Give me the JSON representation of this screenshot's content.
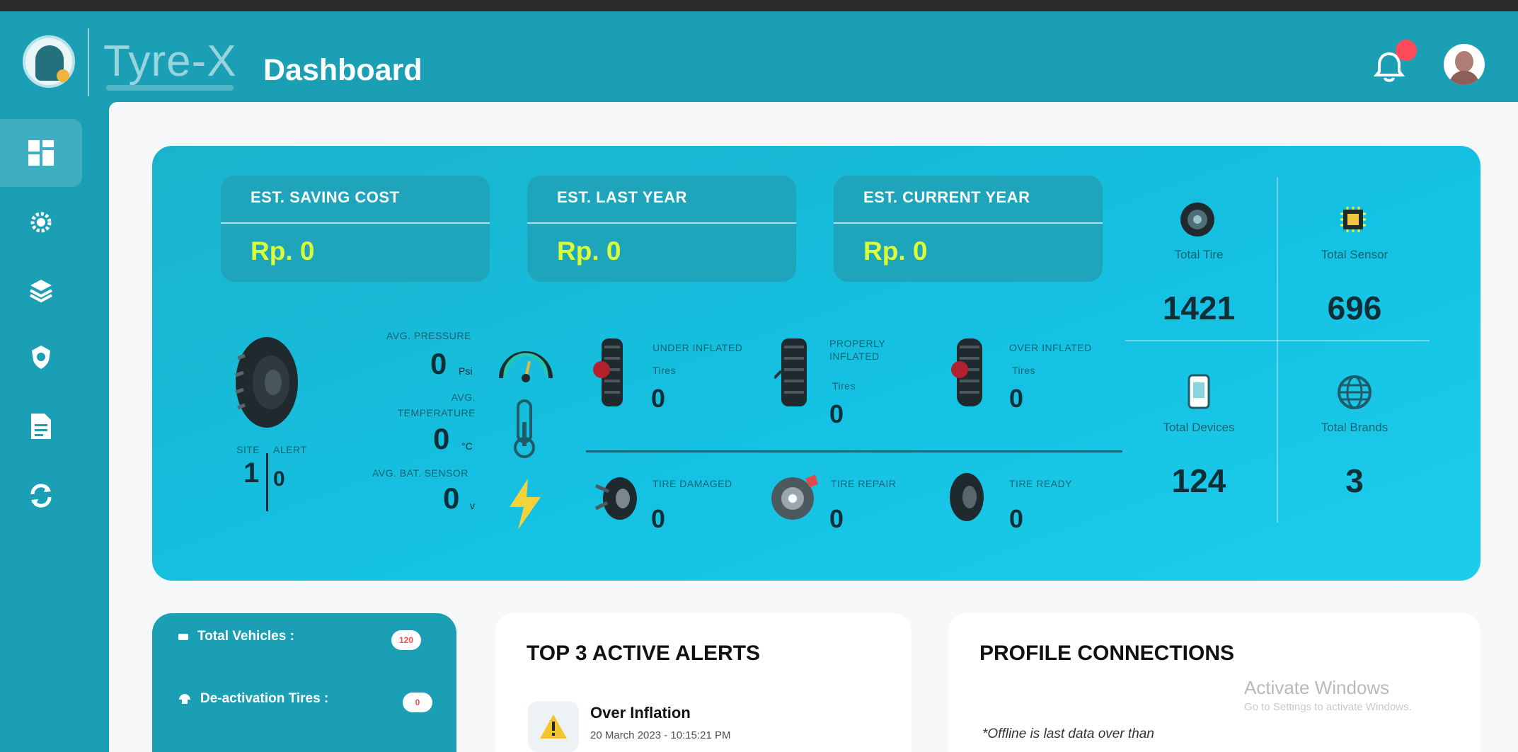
{
  "header": {
    "logo_text": "Tyre-X",
    "page_title": "Dashboard",
    "notification_icon": "bell-icon",
    "avatar_icon": "user-avatar-icon"
  },
  "sidebar": {
    "items": [
      {
        "icon": "dashboard-grid-icon",
        "active": true
      },
      {
        "icon": "settings-gear-icon",
        "active": false
      },
      {
        "icon": "layers-icon",
        "active": false
      },
      {
        "icon": "shield-icon",
        "active": false
      },
      {
        "icon": "report-document-icon",
        "active": false
      },
      {
        "icon": "refresh-icon",
        "active": false
      }
    ]
  },
  "cost_cards": [
    {
      "label": "EST. SAVING COST",
      "value": "Rp. 0"
    },
    {
      "label": "EST. LAST YEAR",
      "value": "Rp. 0"
    },
    {
      "label": "EST. CURRENT YEAR",
      "value": "Rp. 0"
    }
  ],
  "tire_metrics": {
    "site_label": "SITE",
    "alert_label": "ALERT",
    "site_value": "1",
    "alert_value": "0",
    "avg_pressure_label": "AVG. PRESSURE",
    "avg_pressure_value": "0",
    "avg_pressure_unit": "Psi",
    "avg_temperature_label": "AVG. TEMPERATURE",
    "avg_temperature_value": "0",
    "avg_temperature_unit": "°C",
    "avg_battery_label": "AVG. BAT. SENSOR",
    "avg_battery_value": "0",
    "avg_battery_unit": "v"
  },
  "tire_status": [
    {
      "label": "UNDER INFLATED",
      "sublabel": "Tires",
      "value": "0"
    },
    {
      "label": "PROPERLY INFLATED",
      "sublabel": "Tires",
      "value": "0"
    },
    {
      "label": "OVER INFLATED",
      "sublabel": "Tires",
      "value": "0"
    },
    {
      "label": "TIRE DAMAGED",
      "sublabel": "",
      "value": "0"
    },
    {
      "label": "TIRE REPAIR",
      "sublabel": "",
      "value": "0"
    },
    {
      "label": "TIRE READY",
      "sublabel": "",
      "value": "0"
    }
  ],
  "stats": [
    {
      "label": "Total Tire",
      "value": "1421",
      "icon": "tire-icon"
    },
    {
      "label": "Total Sensor",
      "value": "696",
      "icon": "sensor-chip-icon"
    },
    {
      "label": "Total Devices",
      "value": "124",
      "icon": "device-icon"
    },
    {
      "label": "Total Brands",
      "value": "3",
      "icon": "globe-icon"
    }
  ],
  "vehicle_panel": {
    "total_vehicles_label": "Total Vehicles :",
    "total_vehicles_value": "120",
    "deactivation_label": "De-activation Tires :",
    "deactivation_value": "0"
  },
  "alerts_panel": {
    "title": "TOP 3 ACTIVE ALERTS",
    "items": [
      {
        "title": "Over Inflation",
        "time": "20 March 2023 - 10:15:21 PM"
      }
    ]
  },
  "profile_panel": {
    "title": "PROFILE CONNECTIONS",
    "note": "*Offline is last data over than"
  },
  "windows_activation": {
    "title": "Activate Windows",
    "subtitle": "Go to Settings to activate Windows."
  }
}
